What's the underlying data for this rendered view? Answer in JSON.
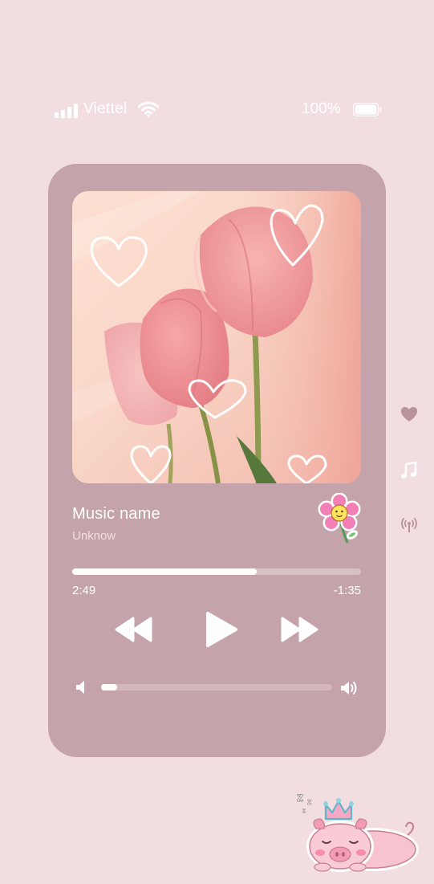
{
  "status_bar": {
    "carrier": "Viettel",
    "battery_percent": "100%",
    "signal_bars": 4
  },
  "player": {
    "song_title": "Music name",
    "artist": "Unknow",
    "time_elapsed": "2:49",
    "time_remaining": "-1:35",
    "progress_fraction": 0.64,
    "volume_fraction": 0.07
  },
  "icons": {
    "rewind": "rewind-icon",
    "play": "play-icon",
    "forward": "fast-forward-icon",
    "volume_low": "volume-low-icon",
    "volume_high": "volume-high-icon",
    "side": [
      "heart-icon",
      "music-note-icon",
      "broadcast-icon"
    ]
  },
  "colors": {
    "background": "#f2dde1",
    "card": "#c4a4aa",
    "track": "#d7c0c4",
    "foreground": "#ffffff"
  }
}
